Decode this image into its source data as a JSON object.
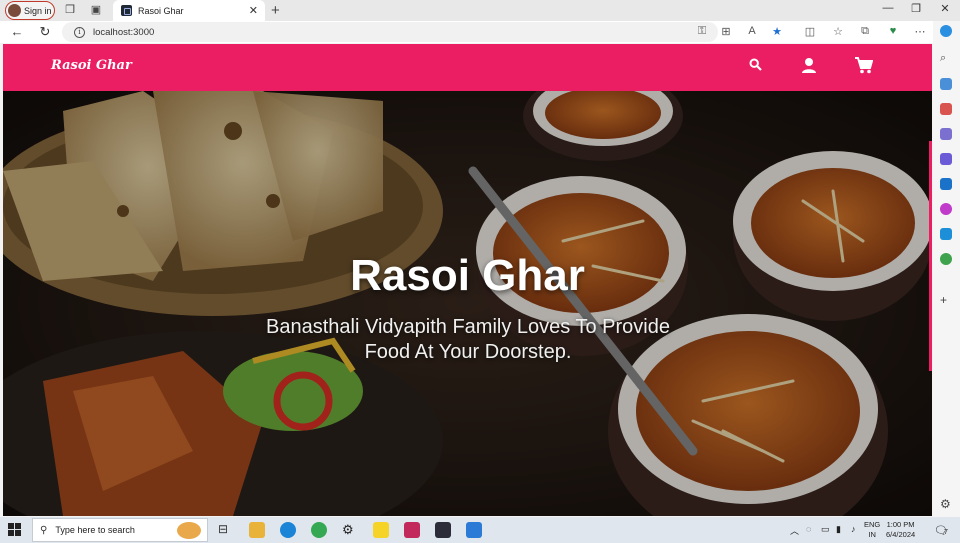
{
  "browser": {
    "signin_label": "Sign in",
    "tab_title": "Rasoi Ghar",
    "url": "localhost:3000"
  },
  "site": {
    "brand": "Rasoi Ghar",
    "hero_title": "Rasoi Ghar",
    "hero_subtitle_line1": "Banasthali Vidyapith Family Loves To Provide",
    "hero_subtitle_line2": "Food At Your Doorstep.",
    "accent_color": "#eb1d63"
  },
  "taskbar": {
    "search_placeholder": "Type here to search",
    "lang_line1": "ENG",
    "lang_line2": "IN",
    "time": "1:00 PM",
    "date": "6/4/2024",
    "notification_count": "7"
  }
}
